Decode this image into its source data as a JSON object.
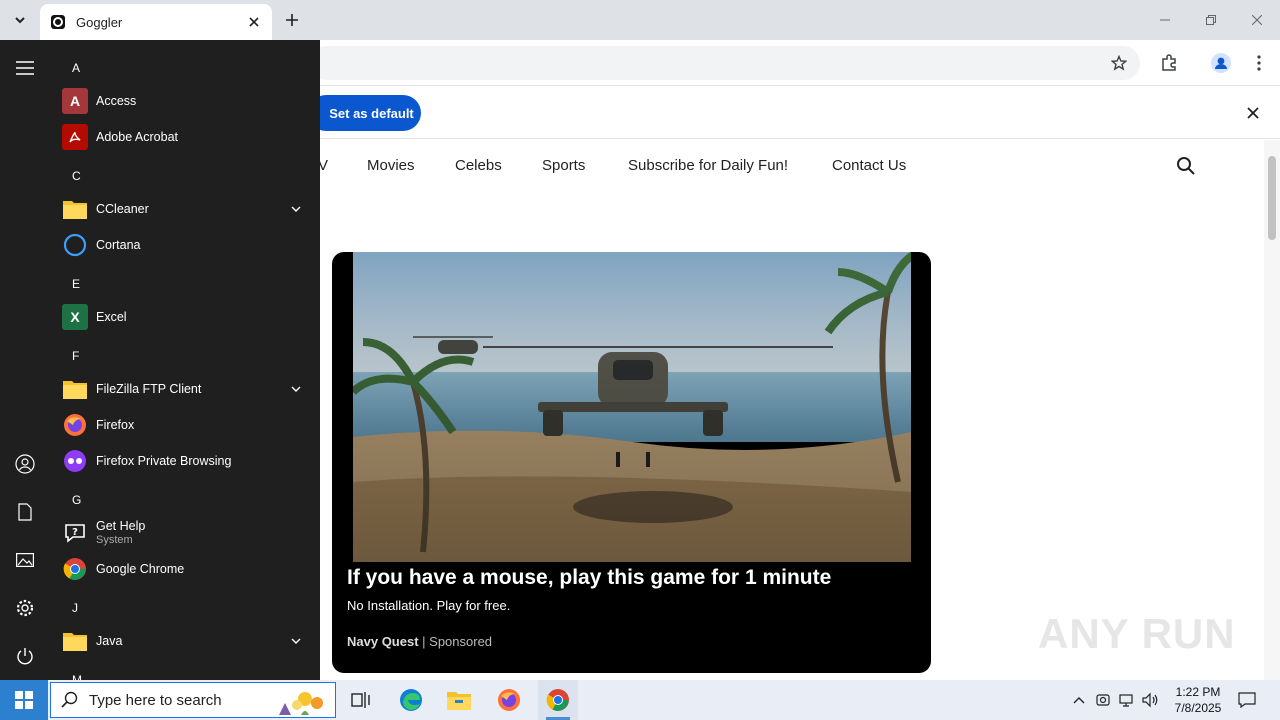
{
  "browser": {
    "tab_title": "Goggler",
    "default_button": "Set as default"
  },
  "page": {
    "nav": [
      "V",
      "Movies",
      "Celebs",
      "Sports",
      "Subscribe for Daily Fun!",
      "Contact Us"
    ],
    "card": {
      "title": "If you have a mouse, play this game for 1 minute",
      "subtitle": "No Installation. Play for free.",
      "source": "Navy Quest",
      "sponsored": "Sponsored"
    },
    "watermark": "ANY RUN"
  },
  "start_menu": {
    "letters": [
      "A",
      "C",
      "E",
      "F",
      "G",
      "J",
      "M"
    ],
    "apps": [
      {
        "label": "Access",
        "icon": "access-icon",
        "color": "#a4373a"
      },
      {
        "label": "Adobe Acrobat",
        "icon": "acrobat-icon",
        "color": "#b30b00"
      },
      {
        "label": "CCleaner",
        "icon": "folder-icon",
        "color": "#f2c12e",
        "expand": true
      },
      {
        "label": "Cortana",
        "icon": "cortana-icon",
        "color": "#3aa0ff"
      },
      {
        "label": "Excel",
        "icon": "excel-icon",
        "color": "#1e7145"
      },
      {
        "label": "FileZilla FTP Client",
        "icon": "folder-icon",
        "color": "#f2c12e",
        "expand": true
      },
      {
        "label": "Firefox",
        "icon": "firefox-icon",
        "color": "#ff7139"
      },
      {
        "label": "Firefox Private Browsing",
        "icon": "firefox-private-icon",
        "color": "#8f3cf7"
      },
      {
        "label": "Get Help",
        "sub": "System",
        "icon": "get-help-icon",
        "color": "#ffffff"
      },
      {
        "label": "Google Chrome",
        "icon": "chrome-icon",
        "color": "#1a73e8"
      },
      {
        "label": "Java",
        "icon": "folder-icon",
        "color": "#f2c12e",
        "expand": true
      }
    ]
  },
  "taskbar": {
    "search_placeholder": "Type here to search",
    "time": "1:22 PM",
    "date": "7/8/2025"
  }
}
